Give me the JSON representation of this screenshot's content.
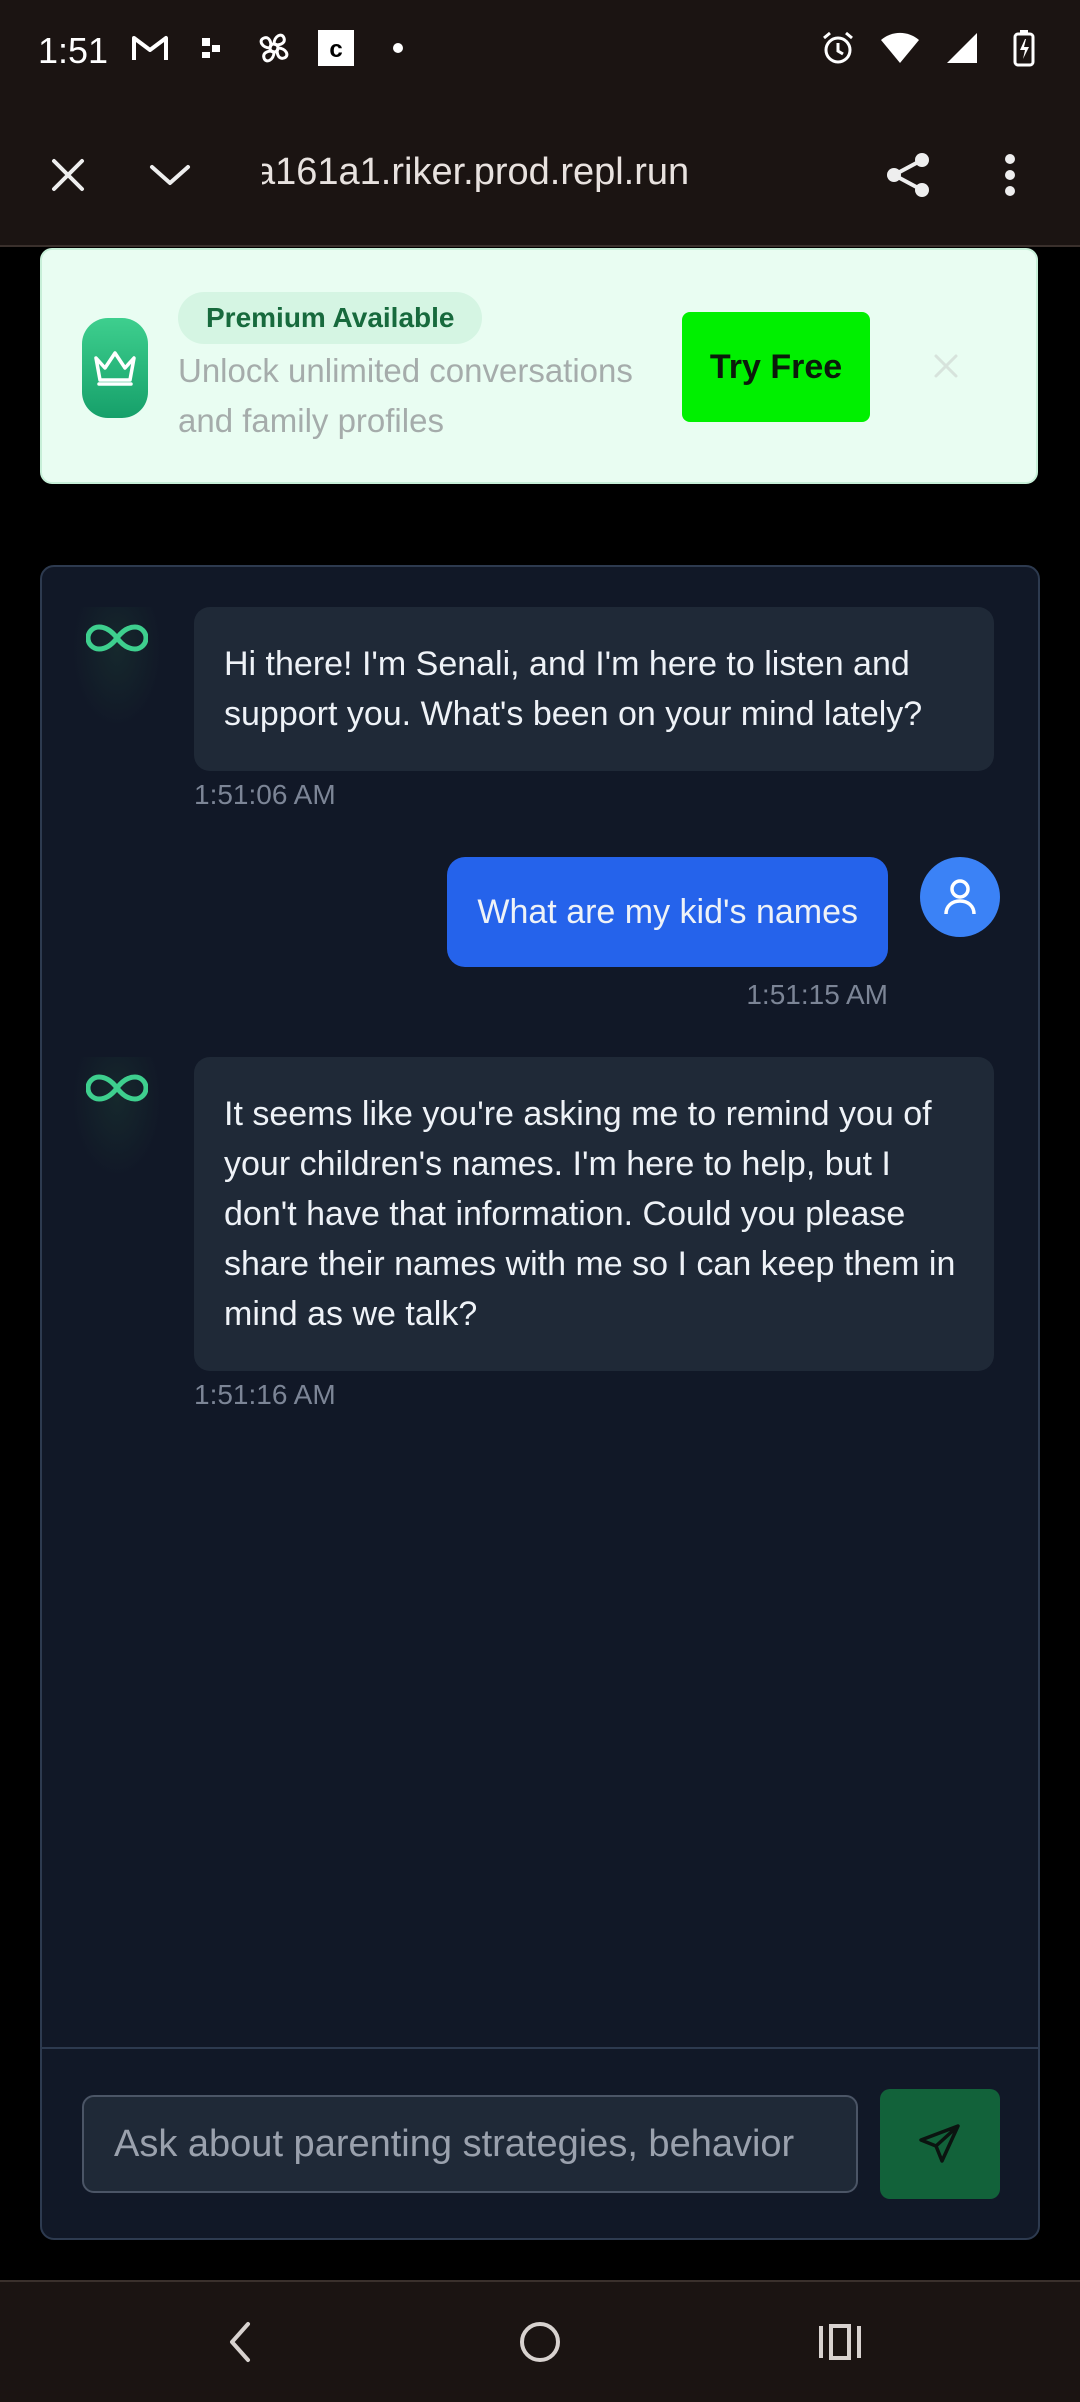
{
  "status_bar": {
    "time": "1:51",
    "left_icons": [
      "gmail-icon",
      "notification-dots-icon",
      "fan-icon",
      "c-app-icon",
      "dot-icon"
    ],
    "right_icons": [
      "alarm-icon",
      "wifi-icon",
      "signal-icon",
      "battery-charging-icon"
    ]
  },
  "browser": {
    "url": "a161a1.riker.prod.repl.run",
    "icons": [
      "close-icon",
      "chevron-down-icon",
      "share-icon",
      "more-vert-icon"
    ]
  },
  "premium_banner": {
    "badge": "Premium Available",
    "description": "Unlock unlimited conversations and family profiles",
    "cta": "Try Free",
    "accent": "#00f000",
    "background": "#e9fdf2"
  },
  "chat": {
    "messages": [
      {
        "sender": "bot",
        "text": "Hi there! I'm Senali, and I'm here to listen and support you. What's been on your mind lately?",
        "time": "1:51:06 AM"
      },
      {
        "sender": "user",
        "text": "What are my kid's names",
        "time": "1:51:15 AM"
      },
      {
        "sender": "bot",
        "text": "It seems like you're asking me to remind you of your children's names. I'm here to help, but I don't have that information. Could you please share their names with me so I can keep them in mind as we talk?",
        "time": "1:51:16 AM"
      }
    ],
    "input_placeholder": "Ask about parenting strategies, behavior",
    "colors": {
      "panel": "#111827",
      "bot_bubble": "#1f2937",
      "user_bubble": "#2563eb",
      "send": "#12623a",
      "infinity": "#3ecf8e"
    }
  },
  "nav_bar": {
    "icons": [
      "back-icon",
      "home-icon",
      "recents-icon"
    ]
  }
}
